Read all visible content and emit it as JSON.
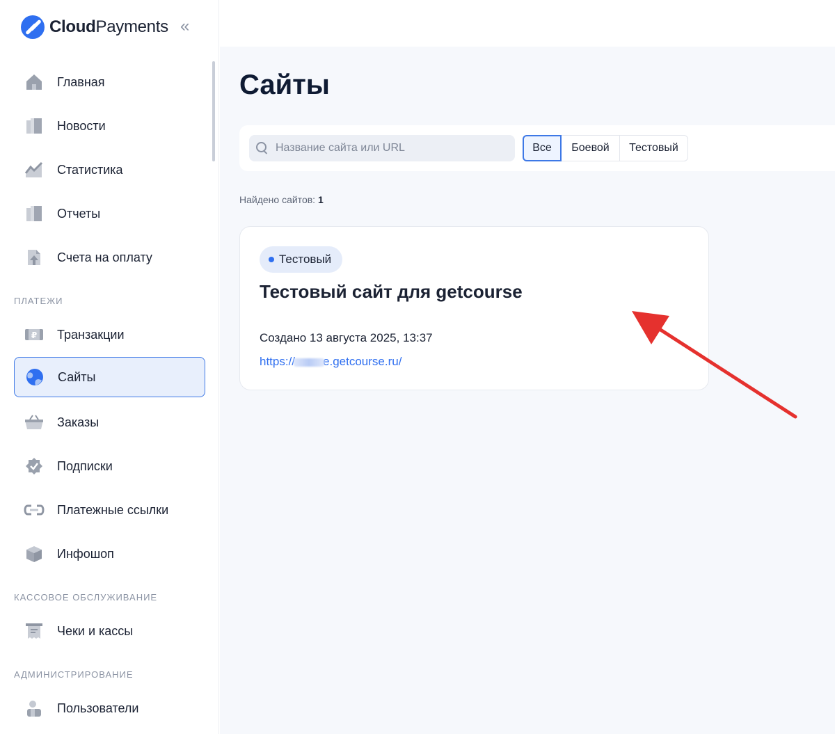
{
  "brand": {
    "bold": "Cloud",
    "regular": "Payments"
  },
  "sidebar": {
    "collapse_icon": "«",
    "items": [
      {
        "label": "Главная",
        "icon": "home-icon"
      },
      {
        "label": "Новости",
        "icon": "news-icon"
      },
      {
        "label": "Статистика",
        "icon": "chart-icon"
      },
      {
        "label": "Отчеты",
        "icon": "report-icon"
      },
      {
        "label": "Счета на оплату",
        "icon": "invoice-icon"
      }
    ],
    "section_payments": "ПЛАТЕЖИ",
    "payments_items": [
      {
        "label": "Транзакции",
        "icon": "ruble-card-icon"
      },
      {
        "label": "Сайты",
        "icon": "globe-icon",
        "active": true
      },
      {
        "label": "Заказы",
        "icon": "basket-icon"
      },
      {
        "label": "Подписки",
        "icon": "badge-check-icon"
      },
      {
        "label": "Платежные ссылки",
        "icon": "link-icon"
      },
      {
        "label": "Инфошоп",
        "icon": "box-icon"
      }
    ],
    "section_cash": "КАССОВОЕ ОБСЛУЖИВАНИЕ",
    "cash_items": [
      {
        "label": "Чеки и кассы",
        "icon": "receipt-icon"
      }
    ],
    "section_admin": "АДМИНИСТРИРОВАНИЕ",
    "admin_items": [
      {
        "label": "Пользователи",
        "icon": "users-icon"
      }
    ]
  },
  "main": {
    "title": "Сайты",
    "search": {
      "placeholder": "Название сайта или URL",
      "value": ""
    },
    "filters": [
      {
        "label": "Все",
        "selected": true
      },
      {
        "label": "Боевой",
        "selected": false
      },
      {
        "label": "Тестовый",
        "selected": false
      }
    ],
    "found_label": "Найдено сайтов:",
    "found_count": "1",
    "sites": [
      {
        "badge": "Тестовый",
        "title": "Тестовый сайт для getcourse",
        "created": "Создано 13 августа 2025, 13:37",
        "url_prefix": "https://",
        "url_suffix": "e.getcourse.ru/"
      }
    ]
  },
  "colors": {
    "accent": "#2f6ff0",
    "arrow": "#e5312e",
    "active_bg": "#e8effc"
  }
}
